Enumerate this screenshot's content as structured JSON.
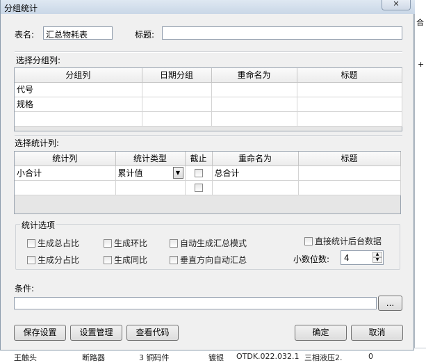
{
  "window": {
    "title": "分组统计",
    "close": "✕"
  },
  "form": {
    "table_name_label": "表名:",
    "table_name_value": "汇总物耗表",
    "title_label": "标题:",
    "title_value": ""
  },
  "group_section": {
    "label": "选择分组列:",
    "headers": [
      "分组列",
      "日期分组",
      "重命名为",
      "标题"
    ],
    "rows": [
      [
        "代号",
        "",
        "",
        ""
      ],
      [
        "规格",
        "",
        "",
        ""
      ],
      [
        "",
        "",
        "",
        ""
      ]
    ]
  },
  "stat_section": {
    "label": "选择统计列:",
    "headers": [
      "统计列",
      "统计类型",
      "截止",
      "重命名为",
      "标题"
    ],
    "rows": [
      {
        "col": "小合计",
        "type": "累计值",
        "cutoff": false,
        "rename": "总合计",
        "title": ""
      },
      {
        "col": "",
        "type": "",
        "cutoff": false,
        "rename": "",
        "title": ""
      }
    ]
  },
  "options": {
    "legend": "统计选项",
    "total_ratio": "生成总占比",
    "ring_ratio": "生成环比",
    "auto_summary_mode": "自动生成汇总模式",
    "direct_backend": "直接统计后台数据",
    "group_ratio": "生成分占比",
    "yoy_ratio": "生成同比",
    "vertical_auto_summary": "垂直方向自动汇总",
    "decimal_label": "小数位数:",
    "decimal_value": "4"
  },
  "condition": {
    "label": "条件:",
    "value": "",
    "browse": "..."
  },
  "buttons": {
    "save_settings": "保存设置",
    "settings_manager": "设置管理",
    "view_code": "查看代码",
    "ok": "确定",
    "cancel": "取消"
  },
  "background": {
    "right_1": "合",
    "right_2": "+",
    "bottom_items": [
      "王触头",
      "断路器",
      "3 铜码件",
      "镀银",
      "OTDK.022.032.1",
      "三相液压2.",
      "0"
    ]
  }
}
